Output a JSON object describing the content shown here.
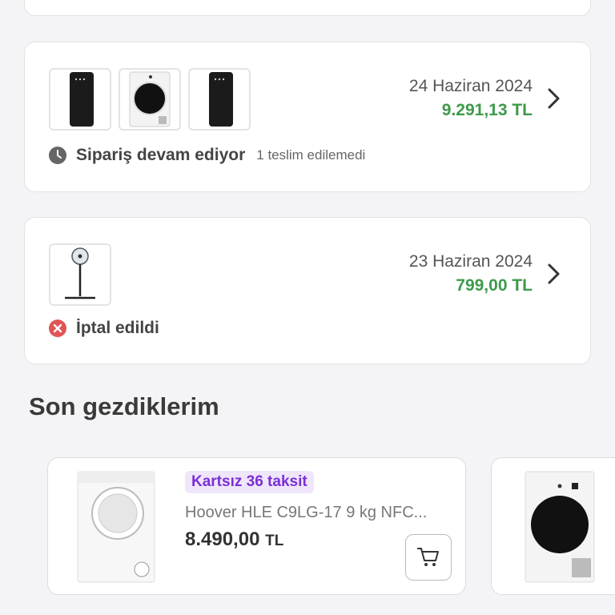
{
  "orders": [
    {
      "date": "24 Haziran 2024",
      "total": "9.291,13 TL",
      "status": "Sipariş devam ediyor",
      "status_detail": "1 teslim edilemedi",
      "status_icon": "clock-icon",
      "thumbnails": [
        "heater-black-thumb",
        "dryer-white-thumb",
        "heater-black-thumb"
      ]
    },
    {
      "date": "23 Haziran 2024",
      "total": "799,00 TL",
      "status": "İptal edildi",
      "status_icon": "cancel-icon",
      "thumbnails": [
        "standing-fan-thumb"
      ]
    }
  ],
  "recently_viewed": {
    "title": "Son gezdiklerim",
    "items": [
      {
        "badge": "Kartsız 36 taksit",
        "name": "Hoover HLE C9LG-17 9 kg NFC...",
        "price": "8.490,00",
        "currency": "TL",
        "action_icon": "cart-icon"
      }
    ]
  },
  "colors": {
    "price_green": "#3d9a4a",
    "badge_bg": "#efe6fb",
    "badge_text": "#7b2fd6",
    "cancel_red": "#e05555",
    "clock_gray": "#666666"
  }
}
